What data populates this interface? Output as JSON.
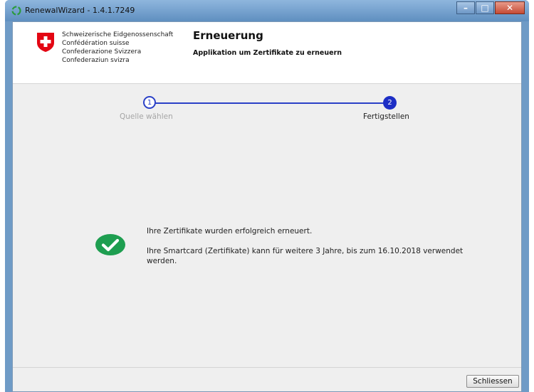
{
  "window": {
    "title": "RenewalWizard - 1.4.1.7249",
    "controls": {
      "minimize": "–",
      "maximize": "□",
      "close": "✕"
    }
  },
  "header": {
    "languages": [
      "Schweizerische Eidgenossenschaft",
      "Confédération suisse",
      "Confederazione Svizzera",
      "Confederaziun svizra"
    ],
    "title": "Erneuerung",
    "subtitle": "Applikation um Zertifikate zu erneuern"
  },
  "steps": [
    {
      "number": "1",
      "label": "Quelle wählen",
      "state": "done"
    },
    {
      "number": "2",
      "label": "Fertigstellen",
      "state": "active"
    }
  ],
  "message": {
    "line1": "Ihre Zertifikate wurden erfolgreich erneuert.",
    "line2": "Ihre Smartcard (Zertifikate) kann für weitere 3 Jahre, bis zum 16.10.2018 verwendet werden."
  },
  "footer": {
    "close_label": "Schliessen"
  },
  "colors": {
    "accent": "#1d2ec5",
    "success": "#1e9e50",
    "swiss_red": "#e30613"
  },
  "icons": {
    "app": "recycle-icon",
    "crest": "swiss-cross-icon",
    "success": "checkmark-icon"
  }
}
